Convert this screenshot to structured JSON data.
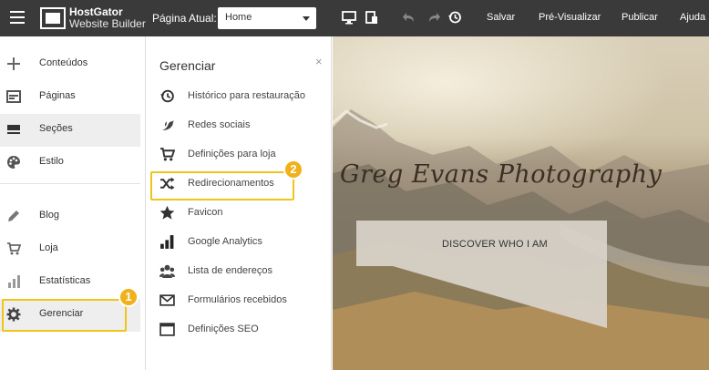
{
  "topbar": {
    "logo_line1": "HostGator",
    "logo_line2": "Website Builder",
    "page_label": "Página Atual:",
    "page_select_value": "Home",
    "save": "Salvar",
    "preview": "Pré-Visualizar",
    "publish": "Publicar",
    "help": "Ajuda"
  },
  "sidebar": {
    "items": [
      {
        "label": "Conteúdos",
        "icon": "plus-icon"
      },
      {
        "label": "Páginas",
        "icon": "pages-icon"
      },
      {
        "label": "Seções",
        "icon": "sections-icon"
      },
      {
        "label": "Estilo",
        "icon": "palette-icon"
      },
      {
        "label": "Blog",
        "icon": "pencil-icon"
      },
      {
        "label": "Loja",
        "icon": "cart-icon"
      },
      {
        "label": "Estatísticas",
        "icon": "bar-chart-icon"
      },
      {
        "label": "Gerenciar",
        "icon": "gear-icon"
      }
    ]
  },
  "manage_panel": {
    "title": "Gerenciar",
    "close": "×",
    "items": [
      {
        "label": "Histórico para restauração",
        "icon": "history-icon"
      },
      {
        "label": "Redes sociais",
        "icon": "bird-icon"
      },
      {
        "label": "Definições para loja",
        "icon": "cart-icon"
      },
      {
        "label": "Redirecionamentos",
        "icon": "shuffle-icon"
      },
      {
        "label": "Favicon",
        "icon": "star-icon"
      },
      {
        "label": "Google Analytics",
        "icon": "analytics-icon"
      },
      {
        "label": "Lista de endereços",
        "icon": "users-icon"
      },
      {
        "label": "Formulários recebidos",
        "icon": "envelope-icon"
      },
      {
        "label": "Definições SEO",
        "icon": "browser-icon"
      }
    ]
  },
  "callouts": {
    "badge1": "1",
    "badge2": "2",
    "color": "#f0c419"
  },
  "preview": {
    "site_title": "Greg Evans Photography",
    "discover_button": "DISCOVER WHO I AM"
  }
}
